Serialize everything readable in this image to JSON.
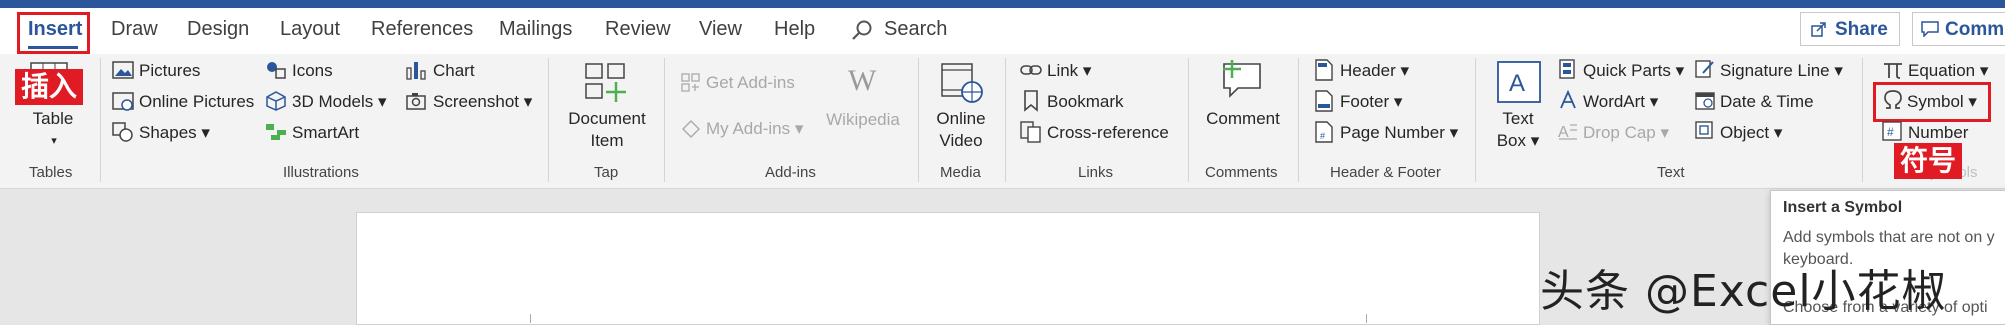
{
  "tabs": {
    "insert": "Insert",
    "draw": "Draw",
    "design": "Design",
    "layout": "Layout",
    "references": "References",
    "mailings": "Mailings",
    "review": "Review",
    "view": "View",
    "help": "Help",
    "search": "Search"
  },
  "header_buttons": {
    "share": "Share",
    "comments": "Comm"
  },
  "annotations": {
    "insert": "插入",
    "symbol": "符号"
  },
  "ribbon": {
    "tables": {
      "table": "Table",
      "group": "Tables"
    },
    "illustrations": {
      "pictures": "Pictures",
      "online_pictures": "Online Pictures",
      "shapes": "Shapes",
      "icons": "Icons",
      "models": "3D Models",
      "smartart": "SmartArt",
      "chart": "Chart",
      "screenshot": "Screenshot",
      "group": "Illustrations"
    },
    "tap": {
      "line1": "Document",
      "line2": "Item",
      "group": "Tap"
    },
    "addins": {
      "get": "Get Add-ins",
      "my": "My Add-ins",
      "wiki": "Wikipedia",
      "group": "Add-ins"
    },
    "media": {
      "line1": "Online",
      "line2": "Video",
      "group": "Media"
    },
    "links": {
      "link": "Link",
      "bookmark": "Bookmark",
      "xref": "Cross-reference",
      "group": "Links"
    },
    "comments": {
      "comment": "Comment",
      "group": "Comments"
    },
    "header_footer": {
      "header": "Header",
      "footer": "Footer",
      "page_number": "Page Number",
      "group": "Header & Footer"
    },
    "text": {
      "textbox1": "Text",
      "textbox2": "Box",
      "quick_parts": "Quick Parts",
      "wordart": "WordArt",
      "drop_cap": "Drop Cap",
      "signature": "Signature Line",
      "datetime": "Date & Time",
      "object": "Object",
      "group": "Text"
    },
    "symbols": {
      "equation": "Equation",
      "symbol": "Symbol",
      "number": "Number",
      "group": "Symbols"
    }
  },
  "tooltip": {
    "title": "Insert a Symbol",
    "line1": "Add symbols that are not on y",
    "line2": "keyboard.",
    "line3": "Choose from a variety of opti"
  },
  "watermark": "头条 @Excel小花椒",
  "colors": {
    "accent": "#2b579a",
    "annotation": "#e01b24"
  }
}
